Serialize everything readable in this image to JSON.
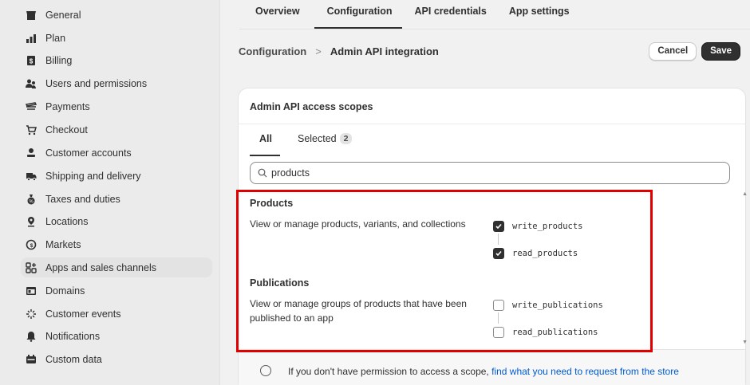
{
  "sidebar": {
    "items": [
      {
        "label": "General",
        "icon": "store-icon"
      },
      {
        "label": "Plan",
        "icon": "plan-icon"
      },
      {
        "label": "Billing",
        "icon": "billing-icon"
      },
      {
        "label": "Users and permissions",
        "icon": "users-icon"
      },
      {
        "label": "Payments",
        "icon": "payments-icon"
      },
      {
        "label": "Checkout",
        "icon": "cart-icon"
      },
      {
        "label": "Customer accounts",
        "icon": "person-icon"
      },
      {
        "label": "Shipping and delivery",
        "icon": "truck-icon"
      },
      {
        "label": "Taxes and duties",
        "icon": "taxes-icon"
      },
      {
        "label": "Locations",
        "icon": "location-icon"
      },
      {
        "label": "Markets",
        "icon": "globe-icon"
      },
      {
        "label": "Apps and sales channels",
        "icon": "apps-icon",
        "active": true
      },
      {
        "label": "Domains",
        "icon": "domain-icon"
      },
      {
        "label": "Customer events",
        "icon": "events-icon"
      },
      {
        "label": "Notifications",
        "icon": "bell-icon"
      },
      {
        "label": "Custom data",
        "icon": "custom-data-icon"
      }
    ]
  },
  "tabs": {
    "overview": "Overview",
    "configuration": "Configuration",
    "api_credentials": "API credentials",
    "app_settings": "App settings",
    "active": "Configuration"
  },
  "header": {
    "breadcrumb_parent": "Configuration",
    "breadcrumb_sep": ">",
    "breadcrumb_current": "Admin API integration",
    "cancel_label": "Cancel",
    "save_label": "Save"
  },
  "card": {
    "title": "Admin API access scopes",
    "tab_all": "All",
    "tab_selected": "Selected",
    "selected_count": "2",
    "search_value": "products",
    "sections": [
      {
        "title": "Products",
        "description": "View or manage products, variants, and collections",
        "scopes": [
          {
            "name": "write_products",
            "checked": true
          },
          {
            "name": "read_products",
            "checked": true
          }
        ]
      },
      {
        "title": "Publications",
        "description": "View or manage groups of products that have been published to an app",
        "scopes": [
          {
            "name": "write_publications",
            "checked": false
          },
          {
            "name": "read_publications",
            "checked": false
          }
        ]
      }
    ]
  },
  "info": {
    "text": "If you don't have permission to access a scope, ",
    "link": "find what you need to request from the store"
  },
  "colors": {
    "highlight": "#e00000",
    "link": "#005bd3",
    "primary": "#303030"
  }
}
